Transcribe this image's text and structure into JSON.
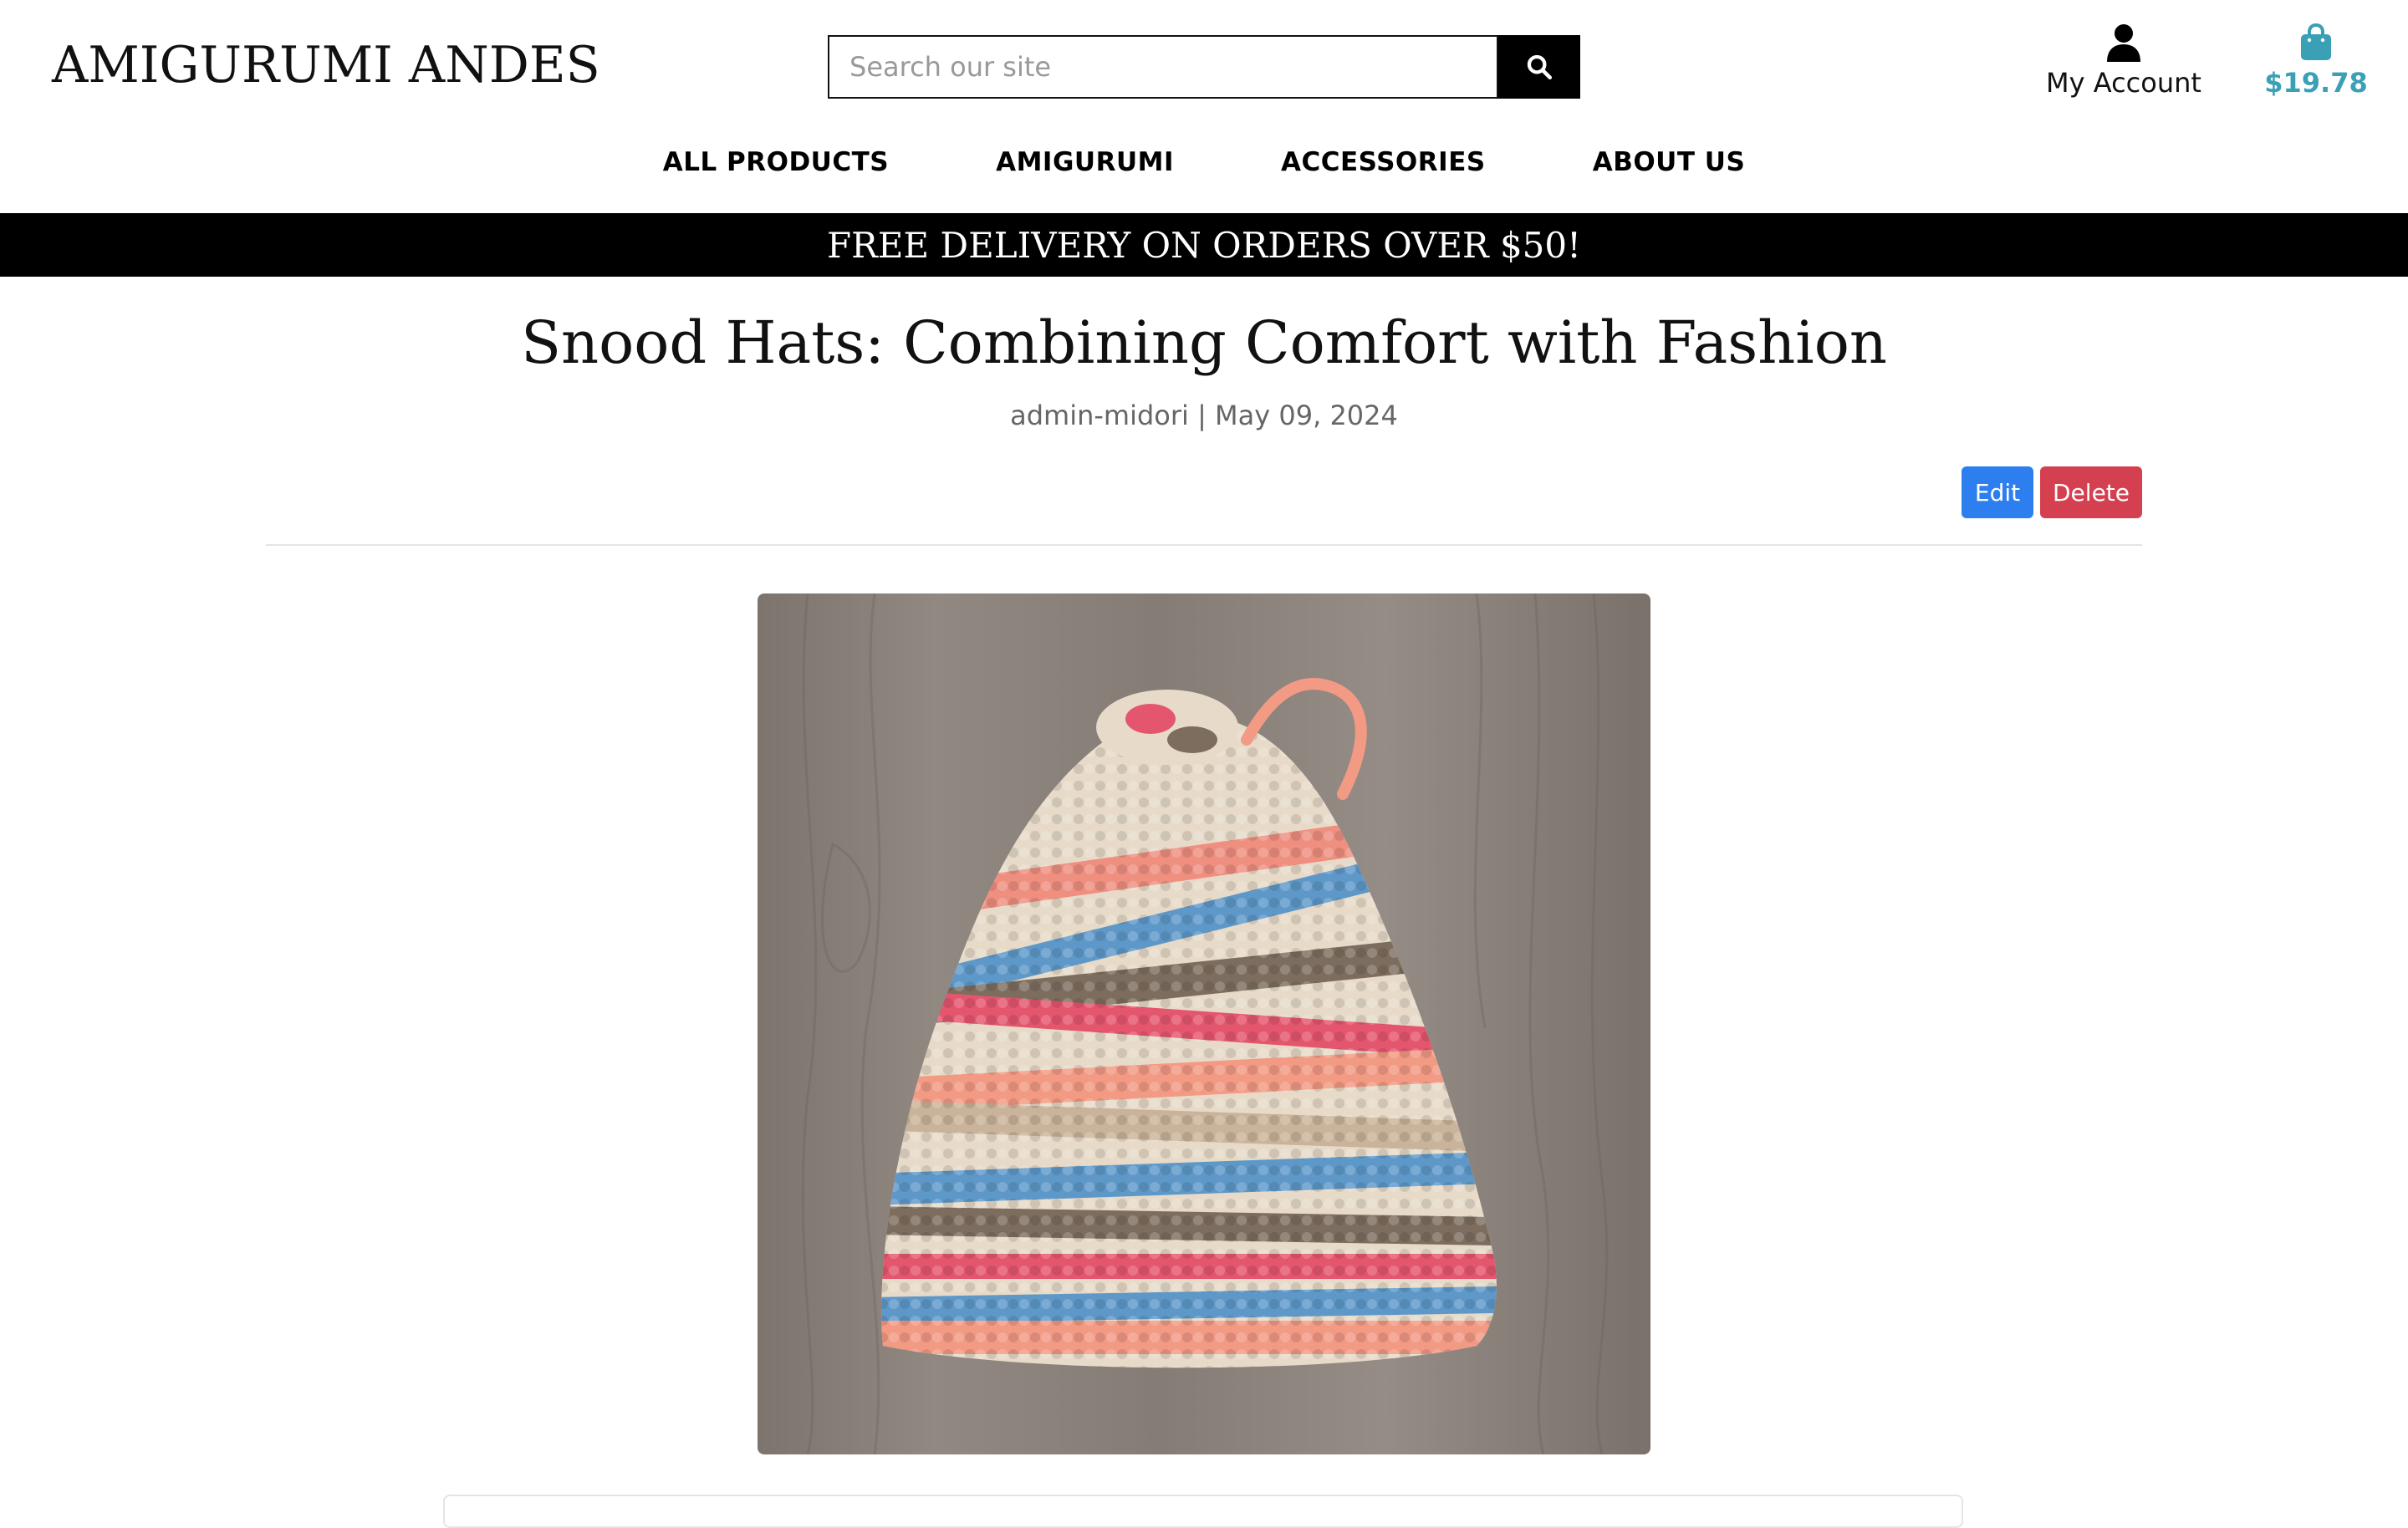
{
  "header": {
    "logo": "AMIGURUMI ANDES",
    "search": {
      "placeholder": "Search our site",
      "value": ""
    },
    "account_label": "My Account",
    "cart_total": "$19.78"
  },
  "nav": {
    "items": [
      "ALL PRODUCTS",
      "AMIGURUMI",
      "ACCESSORIES",
      "ABOUT US"
    ]
  },
  "banner": "FREE DELIVERY ON ORDERS OVER $50!",
  "post": {
    "title": "Snood Hats: Combining Comfort with Fashion",
    "meta": "admin-midori | May 09, 2024",
    "edit_label": "Edit",
    "delete_label": "Delete"
  },
  "colors": {
    "accent": "#3aa0b6",
    "edit": "#2d7ff0",
    "delete": "#d54051",
    "banner_bg": "#000000"
  },
  "icons": {
    "search": "search-icon",
    "account": "user-icon",
    "cart": "shopping-bag-icon"
  }
}
